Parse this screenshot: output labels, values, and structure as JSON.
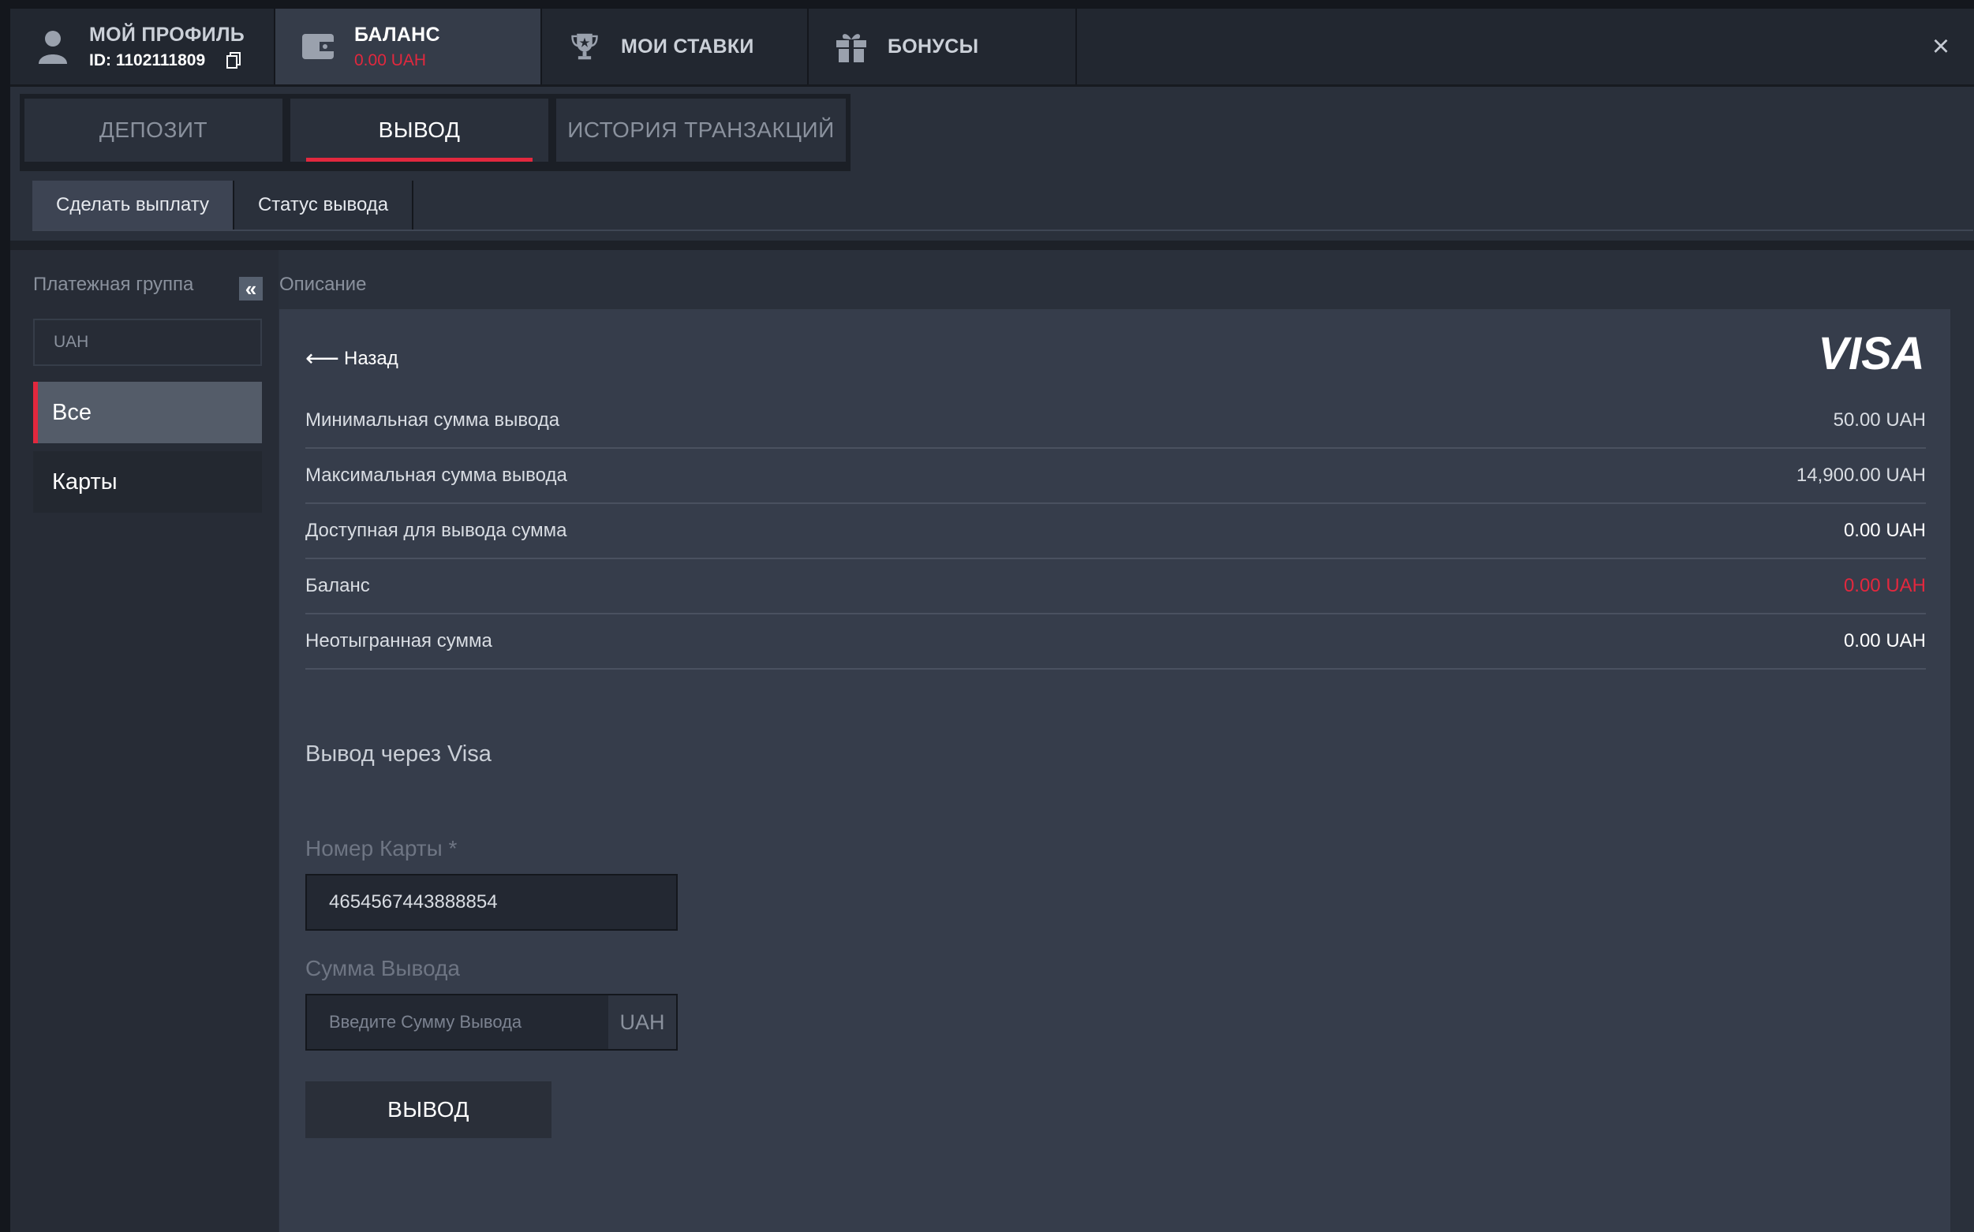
{
  "topnav": {
    "profile": {
      "title": "МОЙ ПРОФИЛЬ",
      "id_text": "ID: 1102111809"
    },
    "balance": {
      "title": "БАЛАНС",
      "amount": "0.00 UAH"
    },
    "bets": {
      "title": "МОИ СТАВКИ"
    },
    "bonuses": {
      "title": "БОНУСЫ"
    },
    "close": "×"
  },
  "tabs": [
    "ДЕПОЗИТ",
    "ВЫВОД",
    "ИСТОРИЯ ТРАНЗАКЦИЙ"
  ],
  "subtabs": [
    "Сделать выплату",
    "Статус вывода"
  ],
  "left": {
    "label": "Платежная группа",
    "collapse": "«",
    "currency": "UAH",
    "items": [
      "Все",
      "Карты"
    ]
  },
  "main": {
    "desc_label": "Описание",
    "back": "Назад",
    "brand": "VISA",
    "rows": [
      {
        "label": "Минимальная сумма вывода",
        "value": "50.00 UAH"
      },
      {
        "label": "Максимальная сумма вывода",
        "value": "14,900.00 UAH"
      },
      {
        "label": "Доступная для вывода сумма",
        "value": "0.00 UAH"
      },
      {
        "label": "Баланс",
        "value": "0.00 UAH"
      },
      {
        "label": "Неотыгранная сумма",
        "value": "0.00 UAH"
      }
    ],
    "section_title": "Вывод через Visa",
    "card_label": "Номер Карты *",
    "card_value": "4654567443888854",
    "amount_label": "Сумма Вывода",
    "amount_placeholder": "Введите Сумму Вывода",
    "amount_suffix": "UAH",
    "submit": "ВЫВОД"
  },
  "colors": {
    "accent": "#e2283e",
    "panel": "#363d4b",
    "background": "#2a303b"
  }
}
